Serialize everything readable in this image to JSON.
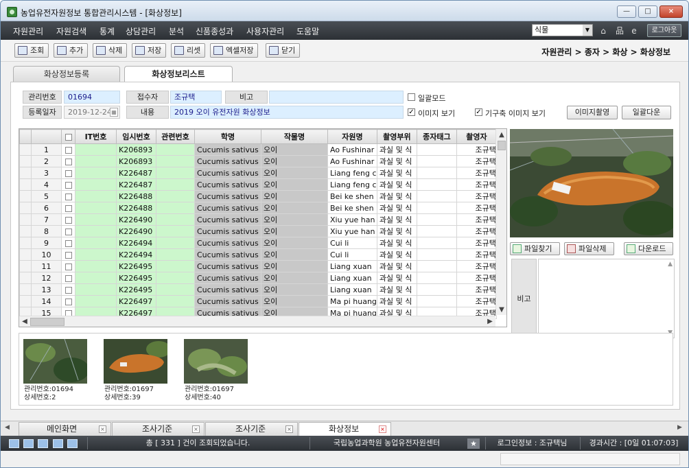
{
  "window": {
    "title": "농업유전자원정보 통합관리시스템 - [화상정보]",
    "controls": [
      "—",
      "□",
      "×"
    ]
  },
  "menu": {
    "items": [
      "자원관리",
      "자원검색",
      "통계",
      "상담관리",
      "분석",
      "신품종성과",
      "사용자관리",
      "도움말"
    ],
    "select_value": "식물",
    "logout_label": "로그아웃"
  },
  "toolbar": {
    "buttons": [
      "조회",
      "추가",
      "삭제",
      "저장",
      "리셋",
      "엑셀저장",
      "닫기"
    ],
    "breadcrumb": "자원관리 > 종자 > 화상 > 화상정보"
  },
  "tabs": [
    "화상정보등록",
    "화상정보리스트"
  ],
  "form": {
    "mgmt_no_label": "관리번호",
    "mgmt_no": "01694",
    "receiver_label": "접수자",
    "receiver": "조규택",
    "memo_label": "비고",
    "memo": "",
    "bulk_mode_label": "일괄모드",
    "reg_date_label": "등록일자",
    "reg_date": "2019-12-24",
    "content_label": "내용",
    "content": "2019 오이 유전자원 화상정보",
    "show_image_label": "이미지 보기",
    "show_orig_label": "기구축 이미지 보기",
    "capture_label": "이미지촬영",
    "bulk_download_label": "일괄다운"
  },
  "grid": {
    "columns": [
      "",
      "",
      "IT번호",
      "임시번호",
      "관련번호",
      "학명",
      "작물명",
      "자원명",
      "촬영부위",
      "종자태그",
      "촬영자"
    ],
    "rows": [
      {
        "n": "1",
        "temp": "K206893",
        "sci": "Cucumis sativus",
        "crop": "오이",
        "name": "Ao Fushinar",
        "part": "과실 및 식",
        "by": "조규택"
      },
      {
        "n": "2",
        "temp": "K206893",
        "sci": "Cucumis sativus",
        "crop": "오이",
        "name": "Ao Fushinar",
        "part": "과실 및 식",
        "by": "조규택"
      },
      {
        "n": "3",
        "temp": "K226487",
        "sci": "Cucumis sativus",
        "crop": "오이",
        "name": "Liang feng c",
        "part": "과실 및 식",
        "by": "조규택"
      },
      {
        "n": "4",
        "temp": "K226487",
        "sci": "Cucumis sativus",
        "crop": "오이",
        "name": "Liang feng c",
        "part": "과실 및 식",
        "by": "조규택"
      },
      {
        "n": "5",
        "temp": "K226488",
        "sci": "Cucumis sativus",
        "crop": "오이",
        "name": "Bei ke shen",
        "part": "과실 및 식",
        "by": "조규택"
      },
      {
        "n": "6",
        "temp": "K226488",
        "sci": "Cucumis sativus",
        "crop": "오이",
        "name": "Bei ke shen",
        "part": "과실 및 식",
        "by": "조규택"
      },
      {
        "n": "7",
        "temp": "K226490",
        "sci": "Cucumis sativus",
        "crop": "오이",
        "name": "Xiu yue han",
        "part": "과실 및 식",
        "by": "조규택"
      },
      {
        "n": "8",
        "temp": "K226490",
        "sci": "Cucumis sativus",
        "crop": "오이",
        "name": "Xiu yue han",
        "part": "과실 및 식",
        "by": "조규택"
      },
      {
        "n": "9",
        "temp": "K226494",
        "sci": "Cucumis sativus",
        "crop": "오이",
        "name": "Cui li",
        "part": "과실 및 식",
        "by": "조규택"
      },
      {
        "n": "10",
        "temp": "K226494",
        "sci": "Cucumis sativus",
        "crop": "오이",
        "name": "Cui li",
        "part": "과실 및 식",
        "by": "조규택"
      },
      {
        "n": "11",
        "temp": "K226495",
        "sci": "Cucumis sativus",
        "crop": "오이",
        "name": "Liang xuan",
        "part": "과실 및 식",
        "by": "조규택"
      },
      {
        "n": "12",
        "temp": "K226495",
        "sci": "Cucumis sativus",
        "crop": "오이",
        "name": "Liang xuan",
        "part": "과실 및 식",
        "by": "조규택"
      },
      {
        "n": "13",
        "temp": "K226495",
        "sci": "Cucumis sativus",
        "crop": "오이",
        "name": "Liang xuan",
        "part": "과실 및 식",
        "by": "조규택"
      },
      {
        "n": "14",
        "temp": "K226497",
        "sci": "Cucumis sativus",
        "crop": "오이",
        "name": "Ma pi huang",
        "part": "과실 및 식",
        "by": "조규택"
      },
      {
        "n": "15",
        "temp": "K226497",
        "sci": "Cucumis sativus",
        "crop": "오이",
        "name": "Ma pi huang",
        "part": "과실 및 식",
        "by": "조규택"
      }
    ]
  },
  "preview": {
    "find_label": "파일찾기",
    "delete_label": "파일삭제",
    "download_label": "다운로드",
    "memo_label": "비고"
  },
  "gallery": [
    {
      "mgmt": "관리번호:01694",
      "detail": "상세번호:2"
    },
    {
      "mgmt": "관리번호:01697",
      "detail": "상세번호:39"
    },
    {
      "mgmt": "관리번호:01697",
      "detail": "상세번호:40"
    }
  ],
  "bottom_tabs": [
    "메인화면",
    "조사기준",
    "조사기준",
    "화상정보"
  ],
  "status": {
    "message": "총 [ 331 ] 건이 조회되었습니다.",
    "org": "국립농업과학원 농업유전자원센터",
    "login": "로그인정보 : 조규택님",
    "elapsed": "경과시간 : [0일 01:07:03]"
  }
}
